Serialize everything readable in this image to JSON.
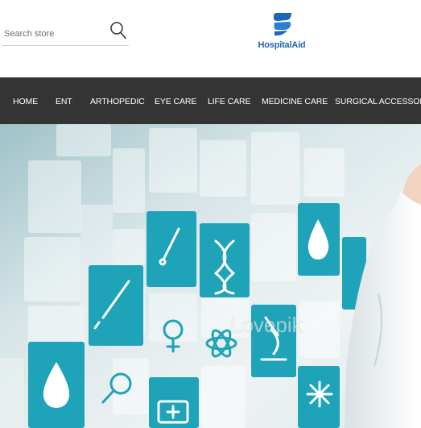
{
  "search": {
    "placeholder": "Search store"
  },
  "logo": {
    "brand": "HospitalAid",
    "colors": {
      "dark": "#1e66b7",
      "light": "#3a8fd8"
    }
  },
  "nav": {
    "items": [
      "HOME",
      "ENT",
      "ARTHOPEDIC",
      "EYE CARE",
      "LIFE CARE",
      "MEDICINE CARE",
      "SURGICAL ACCESSORIES"
    ]
  },
  "hero": {
    "watermark": "Lovepik"
  },
  "colors": {
    "nav_bg": "#343434",
    "tile": "#1fa3b8",
    "tile_light": "#eef3f4"
  }
}
